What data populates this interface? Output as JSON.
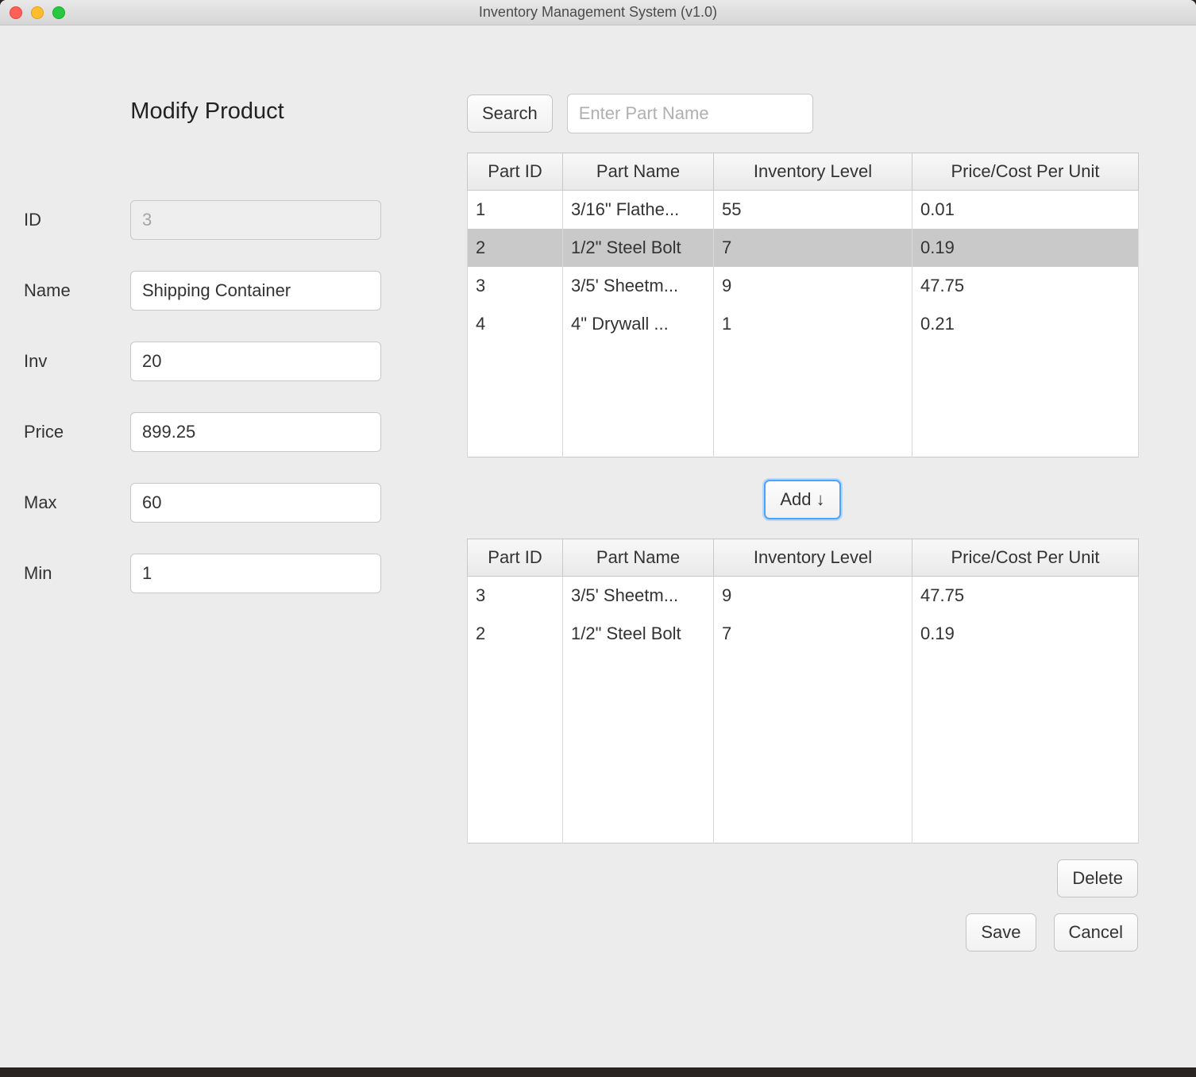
{
  "window": {
    "title": "Inventory Management System (v1.0)"
  },
  "form": {
    "title": "Modify Product",
    "labels": {
      "id": "ID",
      "name": "Name",
      "inv": "Inv",
      "price": "Price",
      "max": "Max",
      "min": "Min"
    },
    "values": {
      "id": "3",
      "name": "Shipping Container",
      "inv": "20",
      "price": "899.25",
      "max": "60",
      "min": "1"
    }
  },
  "search": {
    "button": "Search",
    "placeholder": "Enter Part Name"
  },
  "columns": {
    "id": "Part ID",
    "name": "Part Name",
    "inv": "Inventory Level",
    "price": "Price/Cost Per Unit"
  },
  "parts": {
    "rows": [
      {
        "id": "1",
        "name": "3/16\" Flathe...",
        "inv": "55",
        "price": "0.01"
      },
      {
        "id": "2",
        "name": "1/2\" Steel Bolt",
        "inv": "7",
        "price": "0.19"
      },
      {
        "id": "3",
        "name": "3/5' Sheetm...",
        "inv": "9",
        "price": "47.75"
      },
      {
        "id": "4",
        "name": "4\" Drywall ...",
        "inv": "1",
        "price": "0.21"
      }
    ],
    "selectedIndex": 1,
    "blankRows": 3
  },
  "associated": {
    "rows": [
      {
        "id": "3",
        "name": "3/5' Sheetm...",
        "inv": "9",
        "price": "47.75"
      },
      {
        "id": "2",
        "name": "1/2\" Steel Bolt",
        "inv": "7",
        "price": "0.19"
      }
    ],
    "blankRows": 5
  },
  "buttons": {
    "add": "Add ↓",
    "delete": "Delete",
    "save": "Save",
    "cancel": "Cancel"
  }
}
